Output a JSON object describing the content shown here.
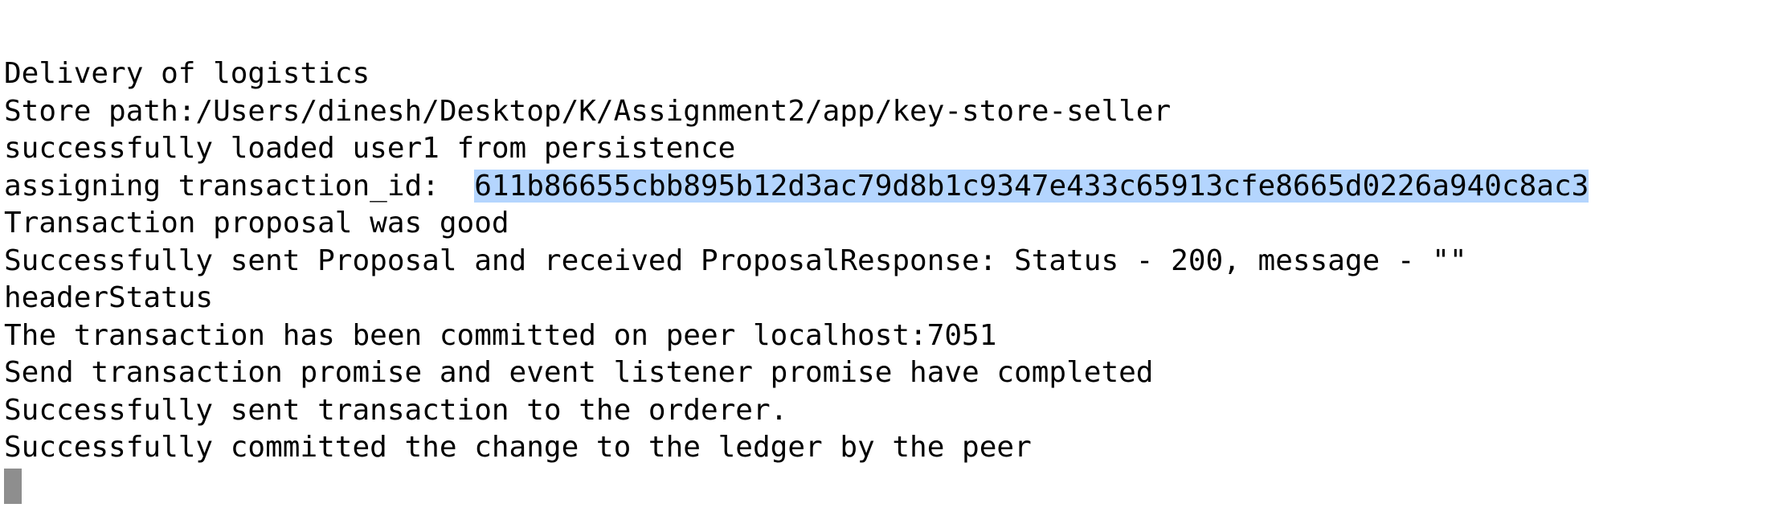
{
  "terminal": {
    "lines": [
      {
        "text": "Delivery of logistics"
      },
      {
        "text": "Store path:/Users/dinesh/Desktop/K/Assignment2/app/key-store-seller"
      },
      {
        "text": "successfully loaded user1 from persistence"
      },
      {
        "prefix": "assigning transaction_id:  ",
        "selected": "611b86655cbb895b12d3ac79d8b1c9347e433c65913cfe8665d0226a940c8ac3"
      },
      {
        "text": "Transaction proposal was good"
      },
      {
        "text": "Successfully sent Proposal and received ProposalResponse: Status - 200, message - \"\""
      },
      {
        "text": "headerStatus"
      },
      {
        "text": "The transaction has been committed on peer localhost:7051"
      },
      {
        "text": "Send transaction promise and event listener promise have completed"
      },
      {
        "text": "Successfully sent transaction to the orderer."
      },
      {
        "text": "Successfully committed the change to the ledger by the peer"
      }
    ],
    "selection_color": "#b4d5fe",
    "cursor_color": "#8e8e8e"
  }
}
